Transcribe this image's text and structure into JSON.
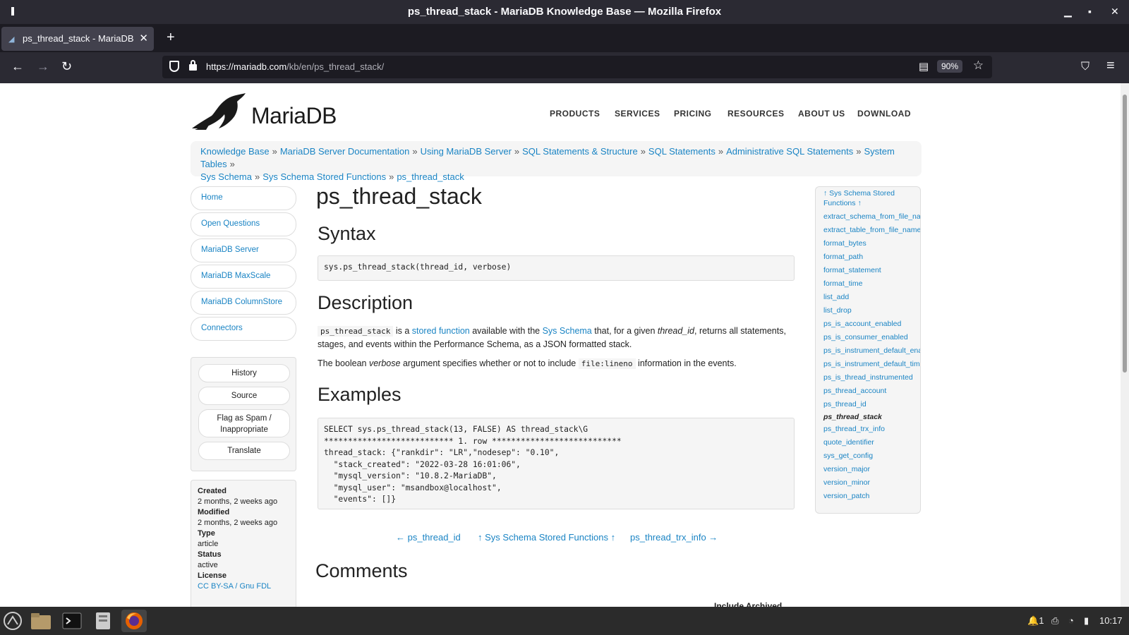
{
  "window": {
    "title": "ps_thread_stack - MariaDB Knowledge Base — Mozilla Firefox",
    "minimize": "▁",
    "maximize": "▪",
    "close": "✕"
  },
  "tabs": [
    {
      "title": "ps_thread_stack - MariaDB K",
      "close": "✕"
    }
  ],
  "new_tab": "+",
  "nav": {
    "back": "←",
    "forward": "→",
    "reload": "↻",
    "url_host": "https://mariadb.com",
    "url_path": "/kb/en/ps_thread_stack/",
    "reader_icon": "▤",
    "zoom": "90%",
    "bookmark_star": "☆",
    "pocket_icon": "⛉",
    "menu_icon": "≡"
  },
  "site": {
    "logo_text": "MariaDB",
    "topnav": [
      "PRODUCTS",
      "SERVICES",
      "PRICING",
      "RESOURCES",
      "ABOUT US",
      "DOWNLOAD"
    ]
  },
  "breadcrumb": [
    "Knowledge Base",
    "MariaDB Server Documentation",
    "Using MariaDB Server",
    "SQL Statements & Structure",
    "SQL Statements",
    "Administrative SQL Statements",
    "System Tables",
    "Sys Schema",
    "Sys Schema Stored Functions",
    "ps_thread_stack"
  ],
  "breadcrumb_sep": "»",
  "sidenav": [
    "Home",
    "Open Questions",
    "MariaDB Server",
    "MariaDB MaxScale",
    "MariaDB ColumnStore",
    "Connectors"
  ],
  "actions": {
    "history": "History",
    "source": "Source",
    "flag": "Flag as Spam / Inappropriate",
    "translate": "Translate"
  },
  "meta": {
    "created_label": "Created",
    "created_value": "2 months, 2 weeks ago",
    "modified_label": "Modified",
    "modified_value": "2 months, 2 weeks ago",
    "type_label": "Type",
    "type_value": "article",
    "status_label": "Status",
    "status_value": "active",
    "license_label": "License",
    "license_value": "CC BY-SA / Gnu FDL"
  },
  "article": {
    "title": "ps_thread_stack",
    "syntax_heading": "Syntax",
    "syntax_code": "sys.ps_thread_stack(thread_id, verbose)",
    "description_heading": "Description",
    "desc_code": "ps_thread_stack",
    "desc_1": " is a ",
    "desc_link_1": "stored function",
    "desc_2": " available with the ",
    "desc_link_2": "Sys Schema",
    "desc_3": " that, for a given ",
    "desc_em": "thread_id",
    "desc_4": ", returns all statements, stages, and events within the Performance Schema, as a JSON formatted stack.",
    "verbose_1": "The boolean ",
    "verbose_em": "verbose",
    "verbose_2": " argument specifies whether or not to include ",
    "verbose_code": "file:lineno",
    "verbose_3": " information in the events.",
    "examples_heading": "Examples",
    "example_code": "SELECT sys.ps_thread_stack(13, FALSE) AS thread_stack\\G\n*************************** 1. row ***************************\nthread_stack: {\"rankdir\": \"LR\",\"nodesep\": \"0.10\",\n  \"stack_created\": \"2022-03-28 16:01:06\",\n  \"mysql_version\": \"10.8.2-MariaDB\",\n  \"mysql_user\": \"msandbox@localhost\",\n  \"events\": []}",
    "prev": "← ps_thread_id",
    "up": "↑ Sys Schema Stored Functions ↑",
    "next": "ps_thread_trx_info →",
    "comments_heading": "Comments",
    "include_archived": "Include Archived"
  },
  "toc": {
    "head": "↑ Sys Schema Stored Functions ↑",
    "items": [
      "extract_schema_from_file_name",
      "extract_table_from_file_name",
      "format_bytes",
      "format_path",
      "format_statement",
      "format_time",
      "list_add",
      "list_drop",
      "ps_is_account_enabled",
      "ps_is_consumer_enabled",
      "ps_is_instrument_default_enabled",
      "ps_is_instrument_default_timed",
      "ps_is_thread_instrumented",
      "ps_thread_account",
      "ps_thread_id",
      "ps_thread_stack",
      "ps_thread_trx_info",
      "quote_identifier",
      "sys_get_config",
      "version_major",
      "version_minor",
      "version_patch"
    ],
    "current": "ps_thread_stack"
  },
  "taskbar": {
    "tray_notif": "1",
    "clock": "10:17"
  },
  "colors": {
    "link": "#1a84c4",
    "chrome_dark": "#2b2a33",
    "tab_active": "#42414d"
  }
}
